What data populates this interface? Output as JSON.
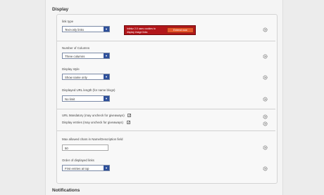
{
  "sections": {
    "display_title": "Display",
    "notifications_title": "Notifications"
  },
  "link_type": {
    "label": "link type",
    "value": "Text-only links"
  },
  "alert": {
    "message": "Inlinkz 2.0 uses cookies to display image links",
    "button_label": "Extend now"
  },
  "columns": {
    "label": "Number of Columns",
    "value": "Three columns"
  },
  "display_style": {
    "label": "Display style",
    "value": "Show name only"
  },
  "url_length": {
    "label": "Displayed URL length (for name blogs)",
    "value": "No limit"
  },
  "checkboxes": {
    "url_mandatory_label": "URL Mandatory (may uncheck for giveaways)",
    "display_entries_label": "Display entries (may uncheck for giveaways)"
  },
  "max_chars": {
    "label": "Max allowed chars in Name/Description field",
    "value": "50"
  },
  "order": {
    "label": "Order of displayed links",
    "value": "First entries at top"
  },
  "icons": {
    "settings": "gear-icon",
    "dropdown": "chevron-down-icon",
    "checkbox": "checkbox-icon"
  },
  "colors": {
    "alert_bg": "#b2161a",
    "alert_button": "#e4572b",
    "select_arrow": "#2d4f9a"
  }
}
